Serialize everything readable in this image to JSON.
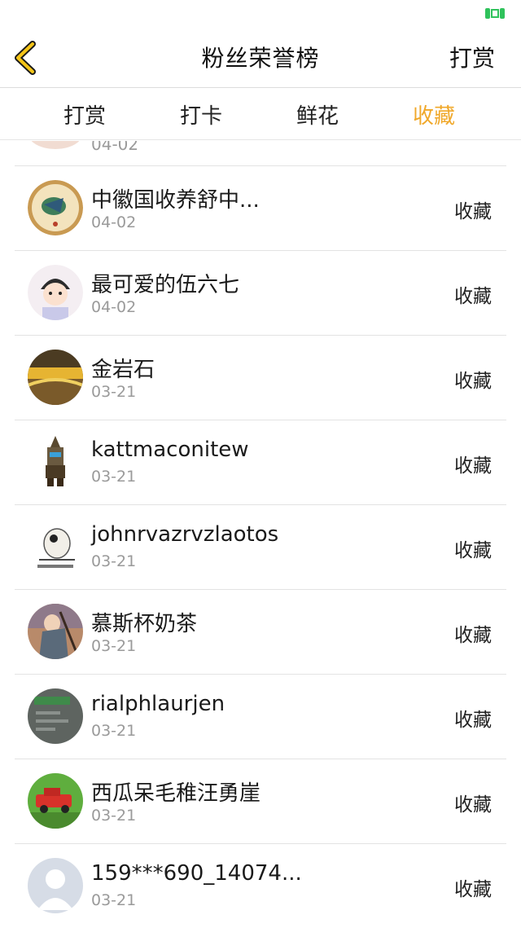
{
  "header": {
    "title": "粉丝荣誉榜",
    "action_label": "打赏"
  },
  "tabs": [
    {
      "label": "打赏",
      "active": false
    },
    {
      "label": "打卡",
      "active": false
    },
    {
      "label": "鲜花",
      "active": false
    },
    {
      "label": "收藏",
      "active": true
    }
  ],
  "accent_color": "#f0a82a",
  "partial_item": {
    "date": "04-02"
  },
  "items": [
    {
      "name": "中徽国收养舒中...",
      "date": "04-02",
      "action": "收藏"
    },
    {
      "name": "最可爱的伍六七",
      "date": "04-02",
      "action": "收藏"
    },
    {
      "name": "金岩石",
      "date": "03-21",
      "action": "收藏"
    },
    {
      "name": "kattmaconitew",
      "date": "03-21",
      "action": "收藏"
    },
    {
      "name": "johnrvazrvzlaotos",
      "date": "03-21",
      "action": "收藏"
    },
    {
      "name": "慕斯杯奶茶",
      "date": "03-21",
      "action": "收藏"
    },
    {
      "name": "rialphlaurjen",
      "date": "03-21",
      "action": "收藏"
    },
    {
      "name": "西瓜呆毛稚汪勇崖",
      "date": "03-21",
      "action": "收藏"
    },
    {
      "name": "159***690_14074...",
      "date": "03-21",
      "action": "收藏"
    }
  ]
}
